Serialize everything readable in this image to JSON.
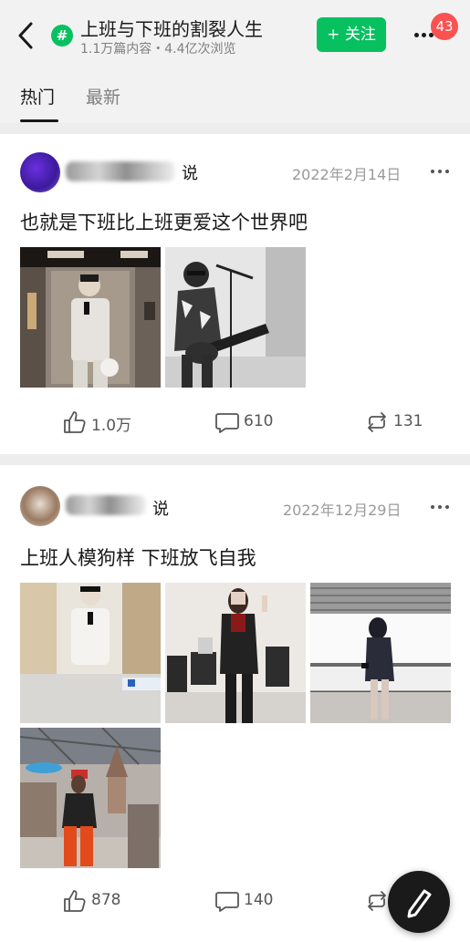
{
  "header": {
    "topic_symbol": "#",
    "title": "上班与下班的割裂人生",
    "stats": "1.1万篇内容・4.4亿次浏览",
    "follow_label": "+ 关注",
    "notification_count": "43"
  },
  "tabs": [
    {
      "label": "热门",
      "active": true
    },
    {
      "label": "最新",
      "active": false
    }
  ],
  "posts": [
    {
      "said": "说",
      "date": "2022年2月14日",
      "text": "也就是下班比上班更爱这个世界吧",
      "photo_count": 2,
      "likes": "1.0万",
      "comments": "610",
      "shares": "131"
    },
    {
      "said": "说",
      "date": "2022年12月29日",
      "text": "上班人模狗样 下班放飞自我",
      "photo_count": 4,
      "likes": "878",
      "comments": "140",
      "shares": ""
    }
  ],
  "colors": {
    "accent": "#07c160",
    "badge": "#fa5151",
    "background": "#ededed"
  },
  "icons": [
    "back-arrow-icon",
    "topic-hash-icon",
    "more-icon",
    "like-icon",
    "comment-icon",
    "repost-icon",
    "pencil-icon"
  ]
}
